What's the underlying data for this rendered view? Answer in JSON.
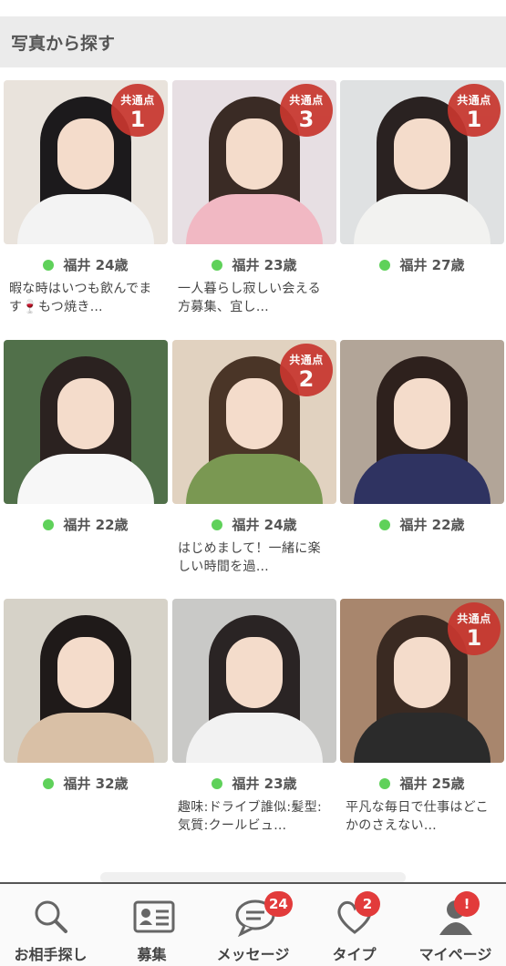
{
  "section": {
    "title": "写真から探す"
  },
  "badge_label": "共通点",
  "profiles": [
    {
      "location_age": "福井 24歳",
      "desc": "暇な時はいつも飲んでます🍷もつ焼き…",
      "common": "1",
      "bg": "#e9e3dc",
      "hair": "#1c1a1c",
      "body": "#f3f3f3"
    },
    {
      "location_age": "福井 23歳",
      "desc": "一人暮らし寂しい会える方募集、宜し…",
      "common": "3",
      "bg": "#e7dfe3",
      "hair": "#3a2b25",
      "body": "#f1b8c3"
    },
    {
      "location_age": "福井 27歳",
      "desc": "",
      "common": "1",
      "bg": "#dfe1e2",
      "hair": "#2a2221",
      "body": "#f2f2f0"
    },
    {
      "location_age": "福井 22歳",
      "desc": "",
      "common": "",
      "bg": "#51704a",
      "hair": "#2b2220",
      "body": "#f7f7f7"
    },
    {
      "location_age": "福井 24歳",
      "desc": "はじめまして！一緒に楽しい時間を過…",
      "common": "2",
      "bg": "#e1d2c0",
      "hair": "#4a3527",
      "body": "#7a9852"
    },
    {
      "location_age": "福井 22歳",
      "desc": "",
      "common": "",
      "bg": "#b2a598",
      "hair": "#2e211d",
      "body": "#2f3361"
    },
    {
      "location_age": "福井 32歳",
      "desc": "",
      "common": "",
      "bg": "#d6d2c8",
      "hair": "#1f1a19",
      "body": "#d9c0a6"
    },
    {
      "location_age": "福井 23歳",
      "desc": "趣味:ドライブ誰似:髪型:気質:クールビュ…",
      "common": "",
      "bg": "#c9c9c7",
      "hair": "#2a2424",
      "body": "#f2f2f2"
    },
    {
      "location_age": "福井 25歳",
      "desc": "平凡な毎日で仕事はどこかのさえない…",
      "common": "1",
      "bg": "#a8866d",
      "hair": "#3a2a22",
      "body": "#2b2b2b"
    }
  ],
  "tabs": [
    {
      "label": "お相手探し",
      "icon": "search-icon",
      "count": ""
    },
    {
      "label": "募集",
      "icon": "id-card-icon",
      "count": ""
    },
    {
      "label": "メッセージ",
      "icon": "chat-icon",
      "count": "24"
    },
    {
      "label": "タイプ",
      "icon": "heart-icon",
      "count": "2"
    },
    {
      "label": "マイページ",
      "icon": "person-icon",
      "count": "!"
    }
  ]
}
